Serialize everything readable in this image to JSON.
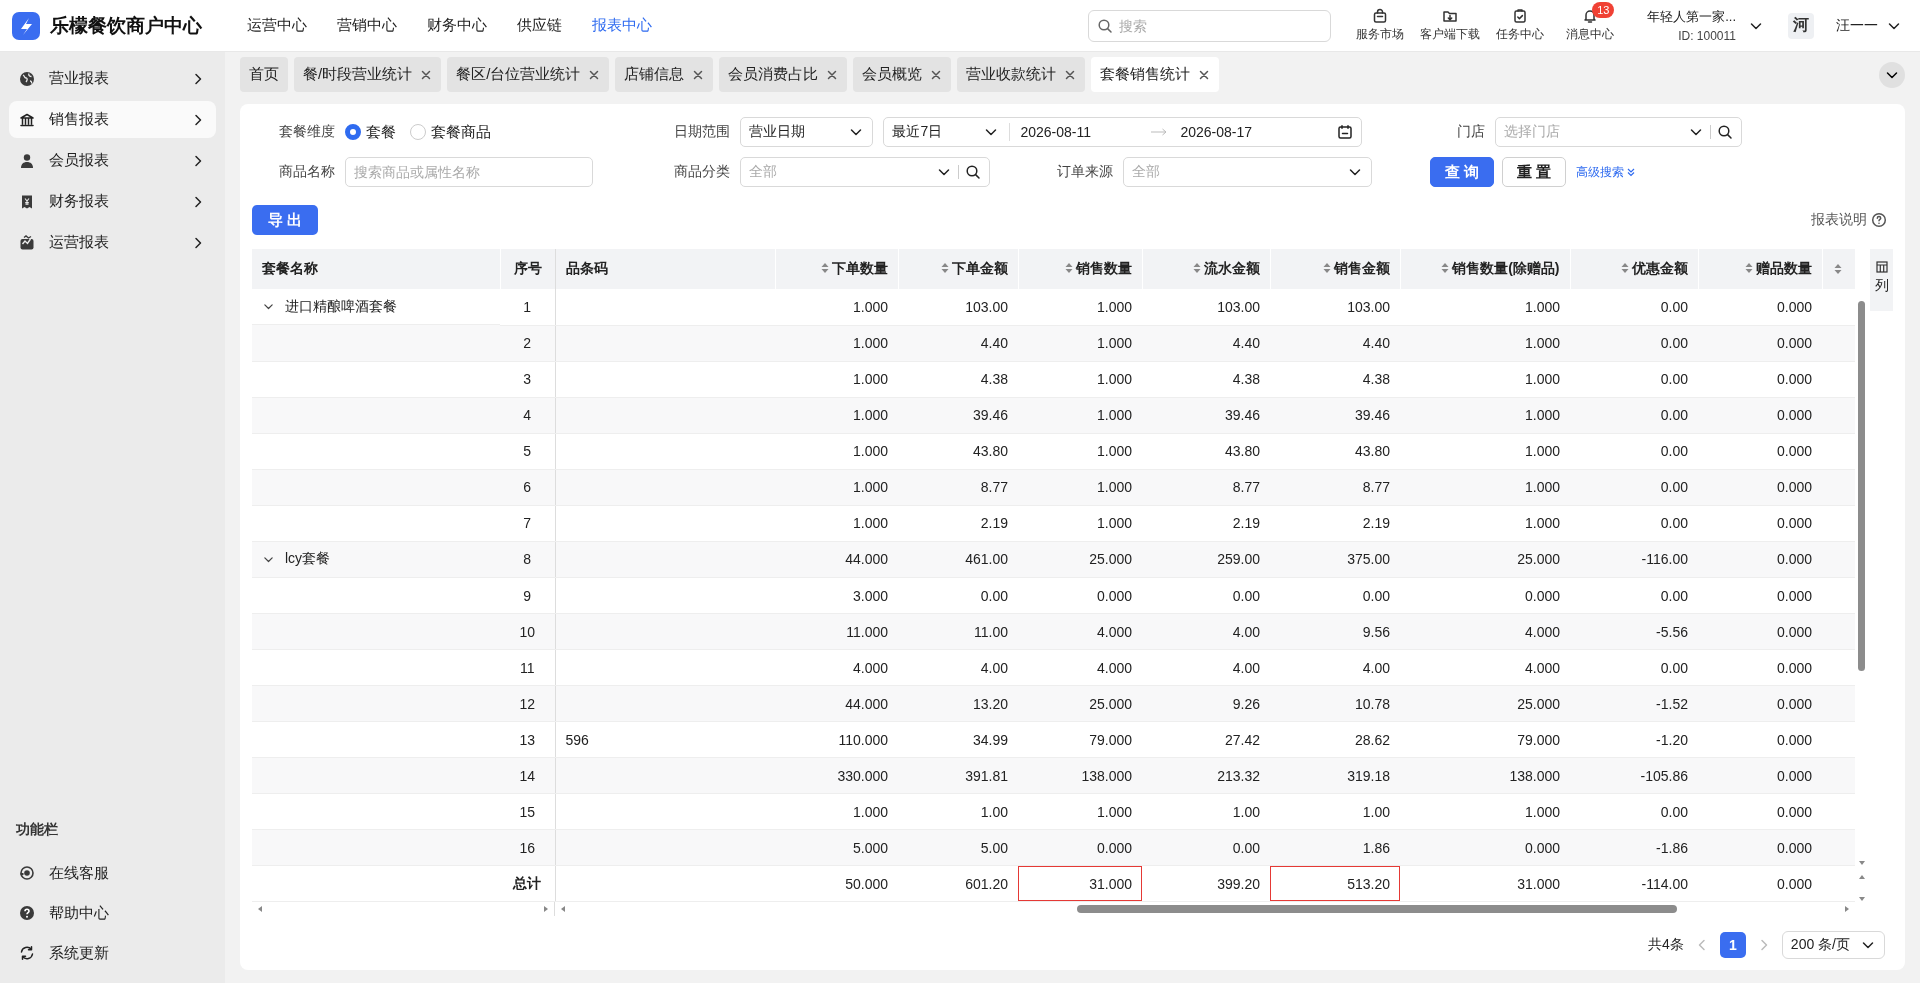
{
  "header": {
    "title": "乐檬餐饮商户中心",
    "nav": [
      {
        "label": "运营中心",
        "selected": false
      },
      {
        "label": "营销中心",
        "selected": false
      },
      {
        "label": "财务中心",
        "selected": false
      },
      {
        "label": "供应链",
        "selected": false
      },
      {
        "label": "报表中心",
        "selected": true
      }
    ],
    "search": {
      "placeholder": "搜索"
    },
    "tools": [
      {
        "label": "服务市场",
        "kind": "bag"
      },
      {
        "label": "客户端下载",
        "kind": "download"
      },
      {
        "label": "任务中心",
        "kind": "task"
      },
      {
        "label": "消息中心",
        "kind": "bell",
        "badge": "13"
      }
    ],
    "account": {
      "name": "年轻人第一家...",
      "id": "ID: 100011"
    },
    "user": {
      "avatar_text": "河",
      "name": "汪一一"
    }
  },
  "sidebar": {
    "items": [
      {
        "label": "营业报表",
        "selected": false
      },
      {
        "label": "销售报表",
        "selected": true
      },
      {
        "label": "会员报表",
        "selected": false
      },
      {
        "label": "财务报表",
        "selected": false
      },
      {
        "label": "运营报表",
        "selected": false
      }
    ],
    "section_title": "功能栏",
    "tools": [
      {
        "label": "在线客服"
      },
      {
        "label": "帮助中心"
      },
      {
        "label": "系统更新"
      }
    ]
  },
  "tabs": [
    {
      "label": "首页",
      "closable": false,
      "selected": false
    },
    {
      "label": "餐/时段营业统计",
      "closable": true,
      "selected": false
    },
    {
      "label": "餐区/台位营业统计",
      "closable": true,
      "selected": false
    },
    {
      "label": "店铺信息",
      "closable": true,
      "selected": false
    },
    {
      "label": "会员消费占比",
      "closable": true,
      "selected": false
    },
    {
      "label": "会员概览",
      "closable": true,
      "selected": false
    },
    {
      "label": "营业收款统计",
      "closable": true,
      "selected": false
    },
    {
      "label": "套餐销售统计",
      "closable": true,
      "selected": true
    }
  ],
  "filter_rows": [
    [
      {
        "kind": "radio",
        "label": "套餐维度",
        "options": [
          {
            "label": "套餐",
            "selected": true
          },
          {
            "label": "套餐商品",
            "selected": false
          }
        ]
      },
      {
        "kind": "daterange",
        "label": "日期范围",
        "type_select": "营业日期",
        "preset": "最近7日",
        "start": "2026-08-11",
        "end": "2026-08-17"
      },
      {
        "kind": "select",
        "label": "门店",
        "placeholder": "选择门店",
        "searchable": true
      }
    ],
    [
      {
        "kind": "input",
        "label": "商品名称",
        "placeholder": "搜索商品或属性名称"
      },
      {
        "kind": "select",
        "label": "商品分类",
        "placeholder": "全部",
        "searchable": true
      },
      {
        "kind": "select",
        "label": "订单来源",
        "placeholder": "全部",
        "searchable": false
      },
      {
        "kind": "actions",
        "buttons": [
          {
            "label": "查 询",
            "primary": true
          },
          {
            "label": "重 置",
            "primary": false
          }
        ],
        "link": "高级搜索"
      }
    ]
  ],
  "toolbar": {
    "export": "导 出",
    "help": "报表说明"
  },
  "table": {
    "columns": [
      {
        "label": "套餐名称",
        "sortable": false
      },
      {
        "label": "序号",
        "sortable": false
      },
      {
        "label": "品条码",
        "sortable": false
      },
      {
        "label": "下单数量",
        "sortable": true
      },
      {
        "label": "下单金额",
        "sortable": true
      },
      {
        "label": "销售数量",
        "sortable": true
      },
      {
        "label": "流水金额",
        "sortable": true
      },
      {
        "label": "销售金额",
        "sortable": true
      },
      {
        "label": "销售数量(除赠品)",
        "sortable": true
      },
      {
        "label": "优惠金额",
        "sortable": true
      },
      {
        "label": "赠品数量",
        "sortable": true
      },
      {
        "sortable": true
      }
    ],
    "settings_label": "列",
    "rows": [
      {
        "name": "进口精酿啤酒套餐",
        "expanded": true,
        "index": "1",
        "values": [
          "1.000",
          "103.00",
          "1.000",
          "103.00",
          "103.00",
          "1.000",
          "0.00",
          "0.000"
        ],
        "children": [
          {
            "index": "2",
            "values": [
              "1.000",
              "4.40",
              "1.000",
              "4.40",
              "4.40",
              "1.000",
              "0.00",
              "0.000"
            ]
          },
          {
            "index": "3",
            "values": [
              "1.000",
              "4.38",
              "1.000",
              "4.38",
              "4.38",
              "1.000",
              "0.00",
              "0.000"
            ]
          },
          {
            "index": "4",
            "values": [
              "1.000",
              "39.46",
              "1.000",
              "39.46",
              "39.46",
              "1.000",
              "0.00",
              "0.000"
            ]
          },
          {
            "index": "5",
            "values": [
              "1.000",
              "43.80",
              "1.000",
              "43.80",
              "43.80",
              "1.000",
              "0.00",
              "0.000"
            ]
          },
          {
            "index": "6",
            "values": [
              "1.000",
              "8.77",
              "1.000",
              "8.77",
              "8.77",
              "1.000",
              "0.00",
              "0.000"
            ]
          },
          {
            "index": "7",
            "values": [
              "1.000",
              "2.19",
              "1.000",
              "2.19",
              "2.19",
              "1.000",
              "0.00",
              "0.000"
            ]
          }
        ]
      },
      {
        "name": "lcy套餐",
        "expanded": true,
        "index": "8",
        "values": [
          "44.000",
          "461.00",
          "25.000",
          "259.00",
          "375.00",
          "25.000",
          "-116.00",
          "0.000"
        ],
        "children": [
          {
            "index": "9",
            "values": [
              "3.000",
              "0.00",
              "0.000",
              "0.00",
              "0.00",
              "0.000",
              "0.00",
              "0.000"
            ]
          },
          {
            "index": "10",
            "values": [
              "11.000",
              "11.00",
              "4.000",
              "4.00",
              "9.56",
              "4.000",
              "-5.56",
              "0.000"
            ]
          },
          {
            "index": "11",
            "values": [
              "4.000",
              "4.00",
              "4.000",
              "4.00",
              "4.00",
              "4.000",
              "0.00",
              "0.000"
            ]
          },
          {
            "index": "12",
            "values": [
              "44.000",
              "13.20",
              "25.000",
              "9.26",
              "10.78",
              "25.000",
              "-1.52",
              "0.000"
            ]
          },
          {
            "index": "13",
            "barcode": "596",
            "values": [
              "110.000",
              "34.99",
              "79.000",
              "27.42",
              "28.62",
              "79.000",
              "-1.20",
              "0.000"
            ]
          },
          {
            "index": "14",
            "values": [
              "330.000",
              "391.81",
              "138.000",
              "213.32",
              "319.18",
              "138.000",
              "-105.86",
              "0.000"
            ]
          },
          {
            "index": "15",
            "values": [
              "1.000",
              "1.00",
              "1.000",
              "1.00",
              "1.00",
              "1.000",
              "0.00",
              "0.000"
            ]
          },
          {
            "index": "16",
            "values": [
              "5.000",
              "5.00",
              "0.000",
              "0.00",
              "1.86",
              "0.000",
              "-1.86",
              "0.000"
            ]
          }
        ]
      }
    ],
    "totals": {
      "label": "总计",
      "values": [
        "50.000",
        "601.20",
        "31.000",
        "399.20",
        "513.20",
        "31.000",
        "-114.00",
        "0.000"
      ],
      "highlighted": [
        false,
        false,
        true,
        false,
        true,
        false,
        false,
        false
      ]
    }
  },
  "pagination": {
    "total": "共4条",
    "pages": [
      {
        "label": "1",
        "selected": true
      }
    ],
    "page_size": "200 条/页"
  }
}
